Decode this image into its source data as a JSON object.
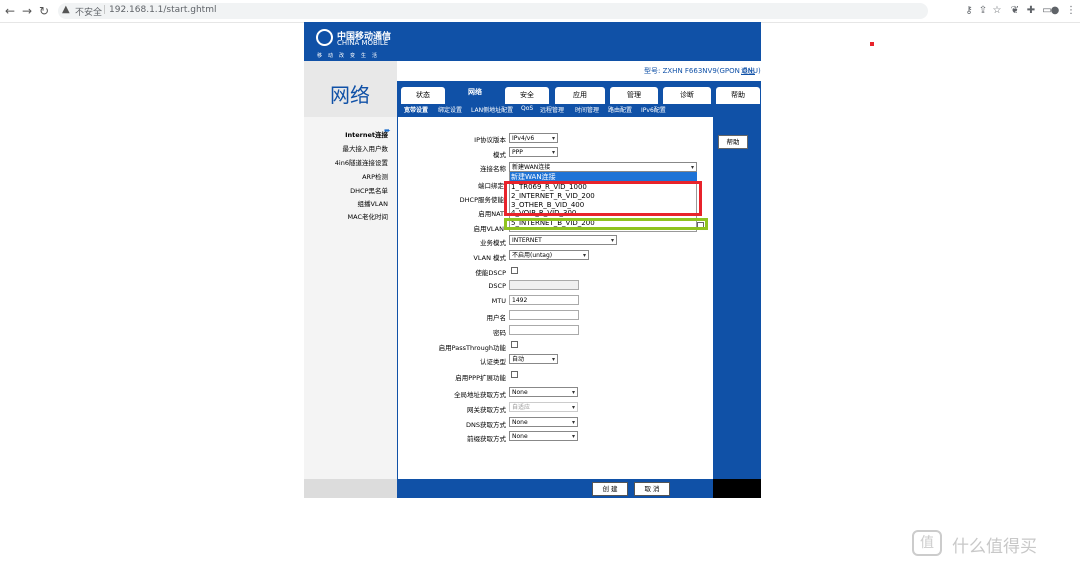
{
  "browser": {
    "security_label": "不安全",
    "url": "192.168.1.1/start.ghtml"
  },
  "router": {
    "brand_cn": "中国移动通信",
    "brand_en": "CHINA MOBILE",
    "brand_sub": "移动改变生活",
    "section_title": "网络",
    "model_label": "型号:",
    "model_value": "ZXHN F663NV9(GPON ONU)",
    "logout": "退出",
    "tabs": [
      "状态",
      "网络",
      "安全",
      "应用",
      "管理",
      "诊断",
      "帮助"
    ],
    "active_tab": "网络",
    "subtabs": [
      "宽带设置",
      "绑定设置",
      "LAN侧地址配置",
      "QoS",
      "远程管理",
      "时间管理",
      "路由配置",
      "IPv6配置"
    ],
    "sidenav": [
      "Internet连接",
      "最大接入用户数",
      "4in6隧道连接设置",
      "ARP检测",
      "DHCP黑名单",
      "组播VLAN",
      "MAC老化时间"
    ],
    "help_button": "帮助",
    "create_button": "创 建",
    "cancel_button": "取 消"
  },
  "form": {
    "ip_version_label": "IP协议版本",
    "ip_version_value": "IPv4/v6",
    "mode_label": "模式",
    "mode_value": "PPP",
    "conn_name_label": "连接名称",
    "conn_name_value": "新建WAN连接",
    "port_label": "端口绑定",
    "dhcp_label": "DHCP服务使能",
    "enable_nat_label": "启用NAT",
    "enable_vlan_label": "启用VLAN",
    "service_mode_label": "业务模式",
    "service_mode_value": "INTERNET",
    "vlan_mode_label": "VLAN 模式",
    "vlan_mode_value": "不启用(untag)",
    "dscp_enable_label": "使能DSCP",
    "dscp_label": "DSCP",
    "mtu_label": "MTU",
    "mtu_value": "1492",
    "username_label": "用户名",
    "password_label": "密码",
    "passthrough_label": "启用PassThrough功能",
    "auth_label": "认证类型",
    "auth_value": "自动",
    "ppp_ext_label": "启用PPP扩展功能",
    "global_addr_label": "全局地址获取方式",
    "global_addr_value": "None",
    "gateway_label": "网关获取方式",
    "gateway_value": "自适应",
    "dns_label": "DNS获取方式",
    "dns_value": "None",
    "prefix_label": "前缀获取方式",
    "prefix_value": "None"
  },
  "dropdown_options": [
    "新建WAN连接",
    "1_TR069_R_VID_1000",
    "2_INTERNET_R_VID_200",
    "3_OTHER_B_VID_400",
    "4_VOIP_R_VID_300",
    "5_INTERNET_B_VID_200"
  ],
  "watermark": "什么值得买",
  "colors": {
    "brand_blue": "#1051a7",
    "highlight_red": "#e8232b",
    "highlight_green": "#8fc31f",
    "selection_blue": "#1e73d6"
  }
}
